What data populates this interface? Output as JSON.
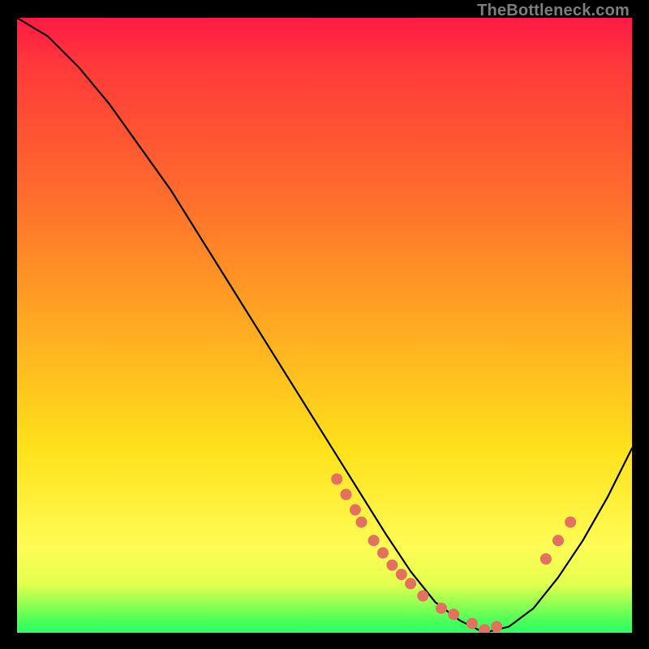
{
  "watermark": {
    "text": "TheBottleneck.com"
  },
  "colors": {
    "background": "#000000",
    "curve": "#000000",
    "marker": "#e47060",
    "gradient_stops": [
      "#ff1a44",
      "#ff3a3a",
      "#ff6a2d",
      "#ffa423",
      "#ffe11a",
      "#fffc55",
      "#e4ff4d",
      "#4dff57",
      "#2bff68"
    ]
  },
  "chart_data": {
    "type": "line",
    "title": "",
    "xlabel": "",
    "ylabel": "",
    "xlim": [
      0,
      100
    ],
    "ylim": [
      0,
      100
    ],
    "grid": false,
    "legend": false,
    "series": [
      {
        "name": "bottleneck-curve",
        "x": [
          0,
          5,
          10,
          15,
          20,
          25,
          30,
          35,
          40,
          45,
          50,
          55,
          60,
          64,
          68,
          72,
          76,
          80,
          84,
          88,
          92,
          96,
          100
        ],
        "values": [
          100,
          97,
          92,
          86,
          79,
          72,
          64,
          56,
          48,
          40,
          32,
          24,
          16,
          10,
          5,
          2,
          0,
          1,
          4,
          9,
          15,
          22,
          30
        ]
      }
    ],
    "markers": {
      "name": "highlighted-points",
      "x": [
        52,
        53.5,
        55,
        56,
        58,
        59.5,
        61,
        62.5,
        64,
        66,
        69,
        71,
        74,
        76,
        78,
        86,
        88,
        90
      ],
      "values": [
        25,
        22.5,
        20,
        18,
        15,
        13,
        11,
        9.5,
        8,
        6,
        4,
        3,
        1.5,
        0.5,
        1,
        12,
        15,
        18
      ]
    }
  }
}
